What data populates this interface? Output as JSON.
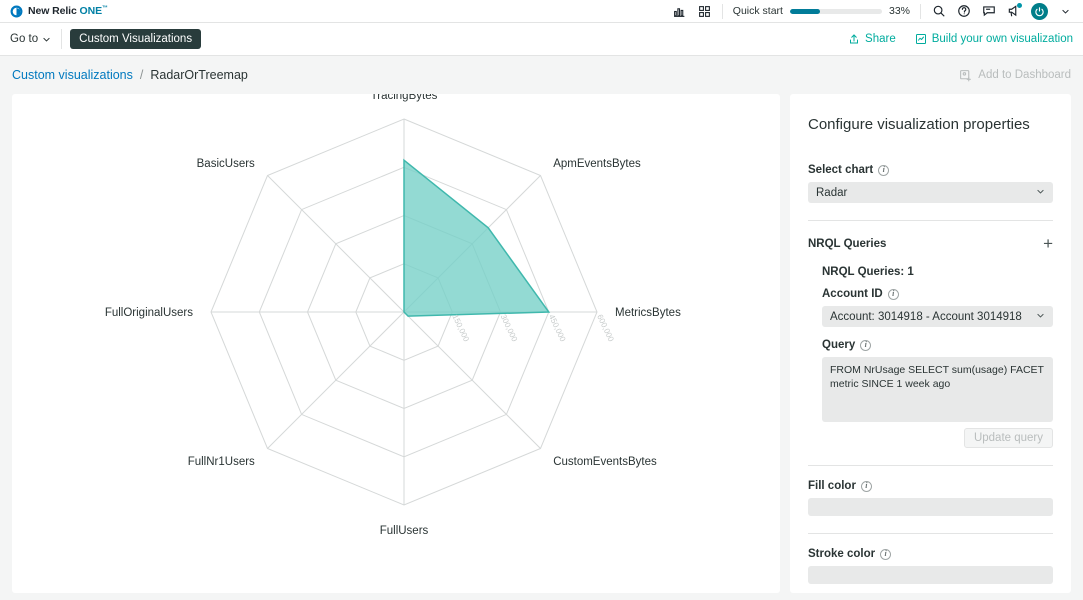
{
  "topbar": {
    "brand_new_relic": "New Relic",
    "brand_one": "ONE",
    "brand_tm": "™",
    "quick_start_label": "Quick start",
    "quick_start_percent_label": "33%",
    "quick_start_percent": 33,
    "icons": {
      "charts": "charts-icon",
      "apps": "apps-grid-icon",
      "search": "search-icon",
      "help": "help-icon",
      "feedback": "feedback-icon",
      "announcements": "announcement-icon",
      "avatar": "user-avatar",
      "caret": "chevron-down-icon"
    },
    "accent_blue": "#017c99",
    "avatar_color": "#007e8a"
  },
  "navbar": {
    "goto_label": "Go to",
    "active_pill_label": "Custom Visualizations",
    "share_label": "Share",
    "build_label": "Build your own visualization",
    "link_color": "#00ac9e"
  },
  "breadcrumb": {
    "parent": "Custom visualizations",
    "separator": "/",
    "current": "RadarOrTreemap",
    "add_to_dashboard_label": "Add to Dashboard",
    "link_color": "#0079bf"
  },
  "panel": {
    "title": "Configure visualization properties",
    "select_chart_label": "Select chart",
    "select_chart_value": "Radar",
    "nrql_queries_label": "NRQL Queries",
    "add_query_icon": "plus-icon",
    "nrql_queries_count_label": "NRQL Queries: 1",
    "account_id_label": "Account ID",
    "account_id_value": "Account: 3014918 - Account 3014918",
    "query_label": "Query",
    "query_value": "FROM NrUsage SELECT sum(usage) FACET metric SINCE 1 week ago",
    "update_query_label": "Update query",
    "fill_color_label": "Fill color",
    "fill_color_value": "",
    "stroke_color_label": "Stroke color",
    "stroke_color_value": ""
  },
  "chart_data": {
    "type": "radar",
    "title": "",
    "categories": [
      "TracingBytes",
      "ApmEventsBytes",
      "MetricsBytes",
      "CustomEventsBytes",
      "FullUsers",
      "FullNr1Users",
      "FullOriginalUsers",
      "BasicUsers"
    ],
    "series": [
      {
        "name": "sum(usage)",
        "values": [
          472000,
          370000,
          450000,
          18000,
          0,
          0,
          0,
          0
        ]
      }
    ],
    "tick_values": [
      150000,
      300000,
      450000,
      600000
    ],
    "tick_labels": [
      "150,000",
      "300,000",
      "450,000",
      "600,000"
    ],
    "rmax": 600000,
    "rings": 4,
    "grid": true,
    "legend": "none",
    "fill_color": "#74cfc6",
    "stroke_color": "#40b8ad",
    "grid_color": "#d5d8d8",
    "tick_label_color": "#c8cccc",
    "axis_label_color": "#2a3434"
  }
}
